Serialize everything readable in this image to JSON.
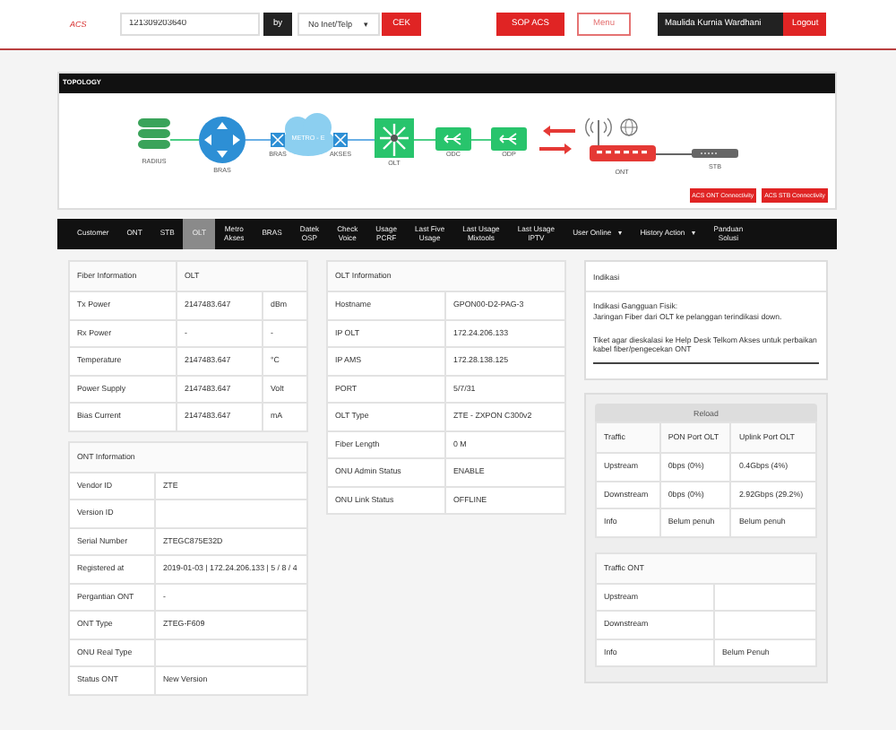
{
  "header": {
    "logo": "ACS",
    "search_value": "121309203640",
    "by_label": "by",
    "search_by": "No Inet/Telp",
    "search_by_caret": "▾",
    "check_button": "CEK",
    "sop_button": "SOP ACS",
    "menu_button": "Menu",
    "user_name": "Maulida Kurnia Wardhani",
    "logout_button": "Logout"
  },
  "topology": {
    "title": "TOPOLOGY",
    "nodes": [
      {
        "kind": "database",
        "label": "RADIUS"
      },
      {
        "kind": "router",
        "label": "BRAS"
      },
      {
        "kind": "cloud",
        "label": "METRO - E",
        "left_label": "BRAS",
        "right_label": "AKSES"
      },
      {
        "kind": "olt",
        "label": "OLT"
      },
      {
        "kind": "splitter",
        "label": "ODC"
      },
      {
        "kind": "splitter",
        "label": "ODP"
      },
      {
        "kind": "ont",
        "label": "ONT"
      },
      {
        "kind": "stb",
        "label": "STB"
      }
    ],
    "buttons": [
      "ACS ONT Connectivity",
      "ACS STB Connectivity"
    ]
  },
  "tabs": [
    {
      "label": "Customer",
      "selected": false
    },
    {
      "label": "ONT",
      "selected": false
    },
    {
      "label": "STB",
      "selected": false
    },
    {
      "label": "OLT",
      "selected": true
    },
    {
      "label": "Metro\nAkses",
      "selected": false
    },
    {
      "label": "BRAS",
      "selected": false
    },
    {
      "label": "Datek\nOSP",
      "selected": false
    },
    {
      "label": "Check\nVoice",
      "selected": false
    },
    {
      "label": "Usage\nPCRF",
      "selected": false
    },
    {
      "label": "Last Five\nUsage",
      "selected": false
    },
    {
      "label": "Last Usage\nMixtools",
      "selected": false
    },
    {
      "label": "Last Usage\nIPTV",
      "selected": false
    },
    {
      "label": "User Online",
      "caret": "▾",
      "selected": false
    },
    {
      "label": "History Action",
      "caret": "▾",
      "selected": false
    },
    {
      "label": "Panduan\nSolusi",
      "selected": false
    }
  ],
  "fiber_information": {
    "columns": [
      "Fiber Information",
      "OLT"
    ],
    "rows": [
      {
        "label": "Tx Power",
        "value": "2147483.647",
        "unit": "dBm"
      },
      {
        "label": "Rx Power",
        "value": "-",
        "unit": "-"
      },
      {
        "label": "Temperature",
        "value": "2147483.647",
        "unit": "°C"
      },
      {
        "label": "Power Supply",
        "value": "2147483.647",
        "unit": "Volt"
      },
      {
        "label": "Bias Current",
        "value": "2147483.647",
        "unit": "mA"
      }
    ]
  },
  "ont_information": {
    "title": "ONT Information",
    "rows": [
      {
        "label": "Vendor ID",
        "value": "ZTE"
      },
      {
        "label": "Version ID"
      },
      {
        "label": "Serial Number",
        "value": "ZTEGC875E32D"
      },
      {
        "label": "Registered at",
        "value": "2019-01-03 | 172.24.206.133 | 5 / 8 / 4"
      },
      {
        "label": "Pergantian ONT",
        "value": "-"
      },
      {
        "label": "ONT Type",
        "value": "ZTEG-F609"
      },
      {
        "label": "ONU Real Type"
      },
      {
        "label": "Status ONT",
        "value": "New Version"
      }
    ]
  },
  "olt_information": {
    "title": "OLT Information",
    "rows": [
      {
        "label": "Hostname",
        "value": "GPON00-D2-PAG-3"
      },
      {
        "label": "IP OLT",
        "value": "172.24.206.133"
      },
      {
        "label": "IP AMS",
        "value": "172.28.138.125"
      },
      {
        "label": "PORT",
        "value": "5/7/31"
      },
      {
        "label": "OLT Type",
        "value": "ZTE - ZXPON C300v2"
      },
      {
        "label": "Fiber Length",
        "value": "0 M"
      },
      {
        "label": "ONU Admin Status",
        "value": "ENABLE"
      },
      {
        "label": "ONU Link Status",
        "value": "OFFLINE"
      }
    ]
  },
  "indikasi": {
    "title": "Indikasi",
    "paragraphs": [
      "Indikasi Gangguan Fisik:\nJaringan Fiber dari OLT ke pelanggan terindikasi down.",
      "Tiket agar dieskalasi ke Help Desk Telkom Akses untuk perbaikan kabel fiber/pengecekan ONT"
    ]
  },
  "traffic": {
    "reload_button": "Reload",
    "columns": [
      "Traffic",
      "PON Port OLT",
      "Uplink Port OLT"
    ],
    "rows": [
      [
        "Upstream",
        "0bps (0%)",
        "0.4Gbps (4%)"
      ],
      [
        "Downstream",
        "0bps (0%)",
        "2.92Gbps (29.2%)"
      ],
      [
        "Info",
        "Belum penuh",
        "Belum penuh"
      ]
    ]
  },
  "traffic_ont": {
    "title": "Traffic ONT",
    "rows": [
      {
        "label": "Upstream"
      },
      {
        "label": "Downstream"
      },
      {
        "label": "Info",
        "value": "Belum Penuh"
      }
    ]
  }
}
